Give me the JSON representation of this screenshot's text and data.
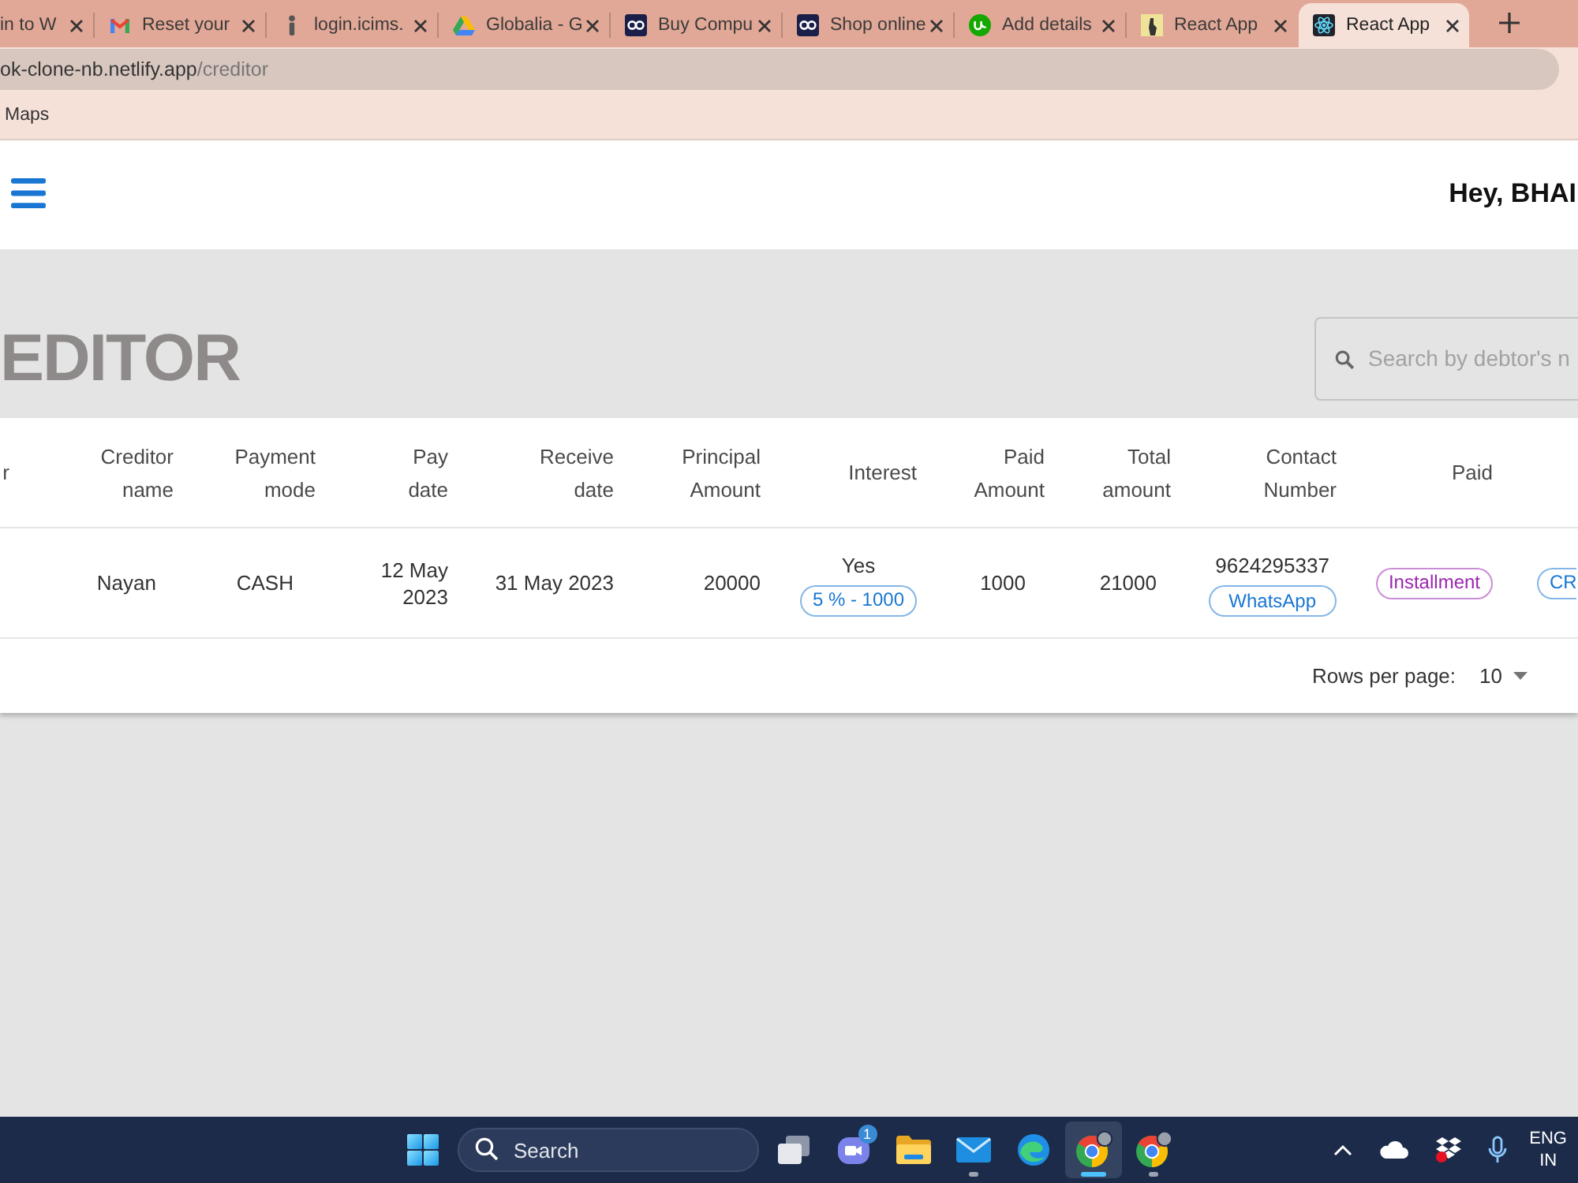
{
  "browser": {
    "tabs": [
      {
        "title": "in to W",
        "selected": false
      },
      {
        "title": "Reset your",
        "kind": "letter",
        "selected": false
      },
      {
        "title": "login.icims.",
        "kind": "person",
        "selected": false
      },
      {
        "title": "Globalia - G",
        "kind": "triangle",
        "selected": false
      },
      {
        "title": "Buy Compu",
        "kind": "goggles",
        "selected": false
      },
      {
        "title": "Shop online",
        "kind": "goggles",
        "selected": false
      },
      {
        "title": "Add details",
        "kind": "disc",
        "selected": false
      },
      {
        "title": "React App",
        "kind": "picture",
        "selected": false
      },
      {
        "title": "React App",
        "kind": "atom",
        "selected": true
      }
    ],
    "address_bar": {
      "host": "ok-clone-nb.netlify.app",
      "path": "/creditor"
    },
    "bookmarks": [
      {
        "label": "Maps"
      }
    ]
  },
  "header": {
    "greeting": "Hey, BHAI"
  },
  "page": {
    "title": "EDITOR",
    "search": {
      "placeholder": "Search by debtor's n"
    }
  },
  "table": {
    "columns": [
      "r",
      "Creditor name",
      "Payment mode",
      "Pay date",
      "Receive date",
      "Principal Amount",
      "Interest",
      "Paid Amount",
      "Total amount",
      "Contact Number",
      "Paid"
    ],
    "rows": [
      {
        "cells": [
          {
            "kind": "blank"
          },
          {
            "kind": "text",
            "text": "Nayan"
          },
          {
            "kind": "text",
            "text": "CASH"
          },
          {
            "kind": "text",
            "text": "12 May 2023"
          },
          {
            "kind": "text",
            "text": "31 May 2023"
          },
          {
            "kind": "text",
            "text": "20000"
          },
          {
            "kind": "text_tag",
            "text": "Yes",
            "tag": "5 % - 1000",
            "color": "#1976d2"
          },
          {
            "kind": "text",
            "text": "1000"
          },
          {
            "kind": "text",
            "text": "21000"
          },
          {
            "kind": "text_button",
            "text": "9624295337",
            "button": "WhatsApp",
            "color": "#1976d2"
          },
          {
            "kind": "tag",
            "tag": "Installment",
            "color": "#9c27b0"
          },
          {
            "kind": "tag",
            "tag": "CR",
            "color": "#1976d2"
          }
        ]
      }
    ],
    "pagination": {
      "label": "Rows per page:",
      "rows_per_page": "10"
    }
  },
  "taskbar": {
    "search": {
      "placeholder": "Search"
    },
    "apps": [
      {
        "kind": "tasks",
        "running": false,
        "selected": false
      },
      {
        "kind": "chat",
        "badge": "1",
        "running": false,
        "selected": false
      },
      {
        "kind": "folder",
        "running": false,
        "selected": false
      },
      {
        "kind": "mail",
        "running": true,
        "selected": false
      },
      {
        "kind": "wave",
        "running": false,
        "selected": false
      },
      {
        "kind": "ring",
        "running": true,
        "selected": true
      },
      {
        "kind": "ring",
        "running": true,
        "selected": false
      }
    ],
    "language": [
      "ENG",
      "IN"
    ]
  }
}
